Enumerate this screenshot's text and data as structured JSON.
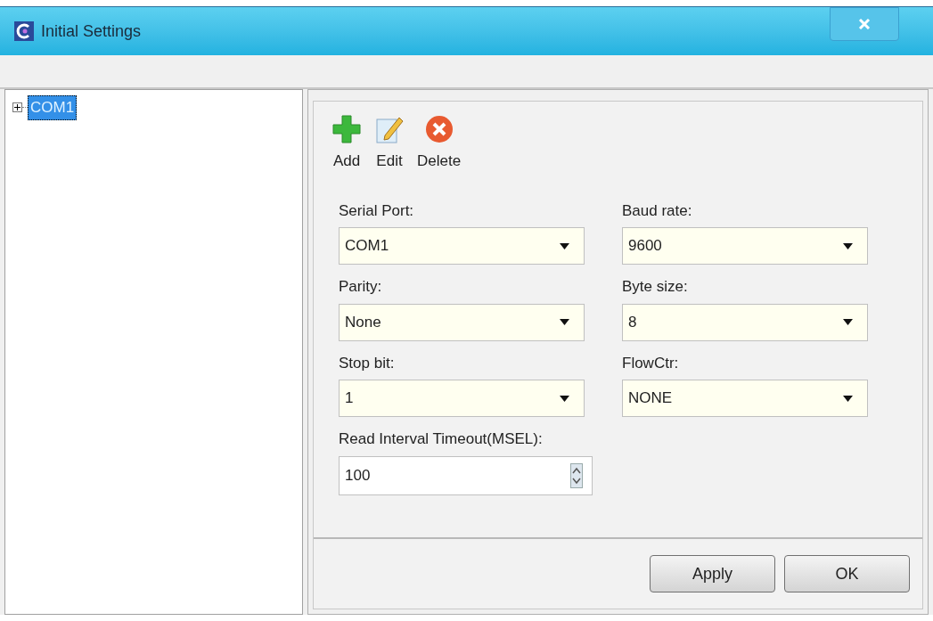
{
  "window": {
    "title": "Initial Settings"
  },
  "tree": [
    {
      "label": "COM1",
      "expanded": false,
      "selected": true
    }
  ],
  "toolbar": [
    {
      "kind": "add",
      "label": "Add"
    },
    {
      "kind": "edit",
      "label": "Edit"
    },
    {
      "kind": "delete",
      "label": "Delete"
    }
  ],
  "fields": [
    {
      "kind": "combo",
      "label": "Serial Port:",
      "value": "COM1"
    },
    {
      "kind": "combo",
      "label": "Baud rate:",
      "value": "9600"
    },
    {
      "kind": "combo",
      "label": "Parity:",
      "value": "None"
    },
    {
      "kind": "combo",
      "label": "Byte size:",
      "value": "8"
    },
    {
      "kind": "combo",
      "label": "Stop bit:",
      "value": "1"
    },
    {
      "kind": "combo",
      "label": "FlowCtr:",
      "value": "NONE"
    },
    {
      "kind": "spin",
      "label": "Read Interval Timeout(MSEL):",
      "value": "100"
    }
  ],
  "buttons": [
    "Apply",
    "OK"
  ]
}
